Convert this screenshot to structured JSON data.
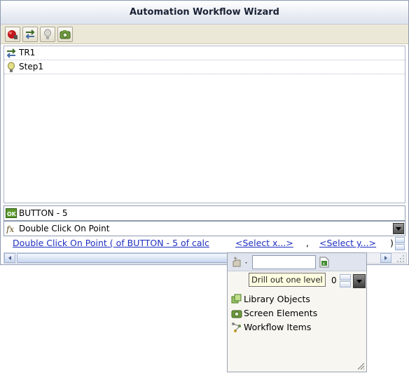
{
  "window": {
    "title": "Automation Workflow Wizard"
  },
  "toolbar": {
    "buttons": [
      {
        "icon": "record-icon"
      },
      {
        "icon": "transition-icon"
      },
      {
        "icon": "step-bulb-icon"
      },
      {
        "icon": "camera-icon"
      }
    ]
  },
  "tree": {
    "items": [
      {
        "label": "TR1",
        "icon": "transition-icon"
      },
      {
        "label": "Step1",
        "icon": "step-bulb-icon"
      }
    ]
  },
  "target_field": {
    "label": "BUTTON - 5",
    "icon": "ok-button-icon"
  },
  "action_field": {
    "label": "Double Click On Point",
    "icon": "function-icon"
  },
  "expression": {
    "main_link": "Double Click On Point ( of BUTTON - 5 of calc",
    "x_link": "<Select x...>",
    "separator": ",",
    "y_link": "<Select y...>",
    "close": ")"
  },
  "popup": {
    "search_value": "",
    "tooltip": "Drill out one level",
    "level_value": "0",
    "items": [
      {
        "label": "Library Objects",
        "icon": "library-icon"
      },
      {
        "label": "Screen Elements",
        "icon": "camera-icon"
      },
      {
        "label": "Workflow Items",
        "icon": "workflow-icon"
      }
    ]
  },
  "colors": {
    "link": "#1f2fbf",
    "toolbar_bg": "#ece8d8",
    "tooltip_bg": "#ffffe1"
  }
}
